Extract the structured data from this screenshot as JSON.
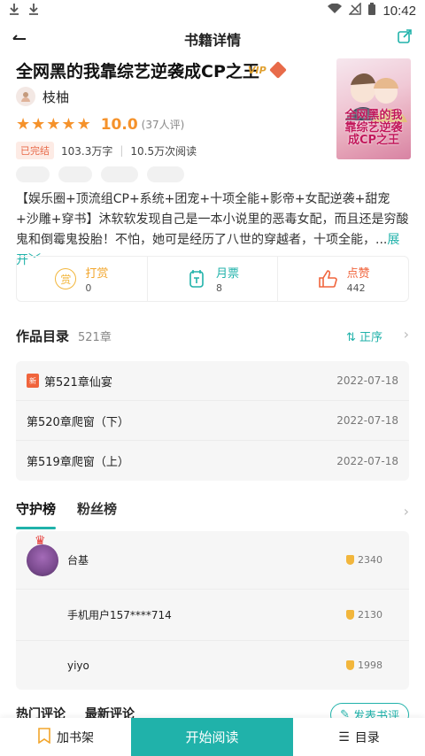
{
  "status_bar": {
    "time": "10:42",
    "left_icons": [
      "download-icon",
      "download-icon"
    ],
    "right_icons": [
      "wifi-icon",
      "signal-off-icon",
      "battery-icon"
    ]
  },
  "navbar": {
    "title": "书籍详情",
    "back_icon": "back-arrow-icon",
    "share_icon": "share-icon"
  },
  "book": {
    "title": "全网黑的我靠综艺逆袭成CP之王",
    "vip_label": "VIP",
    "author": "枝柚",
    "rating": 5,
    "score": "10.0",
    "reviews": "(37人评)",
    "status": "已完结",
    "word_count": "103.3万字",
    "separator": "|",
    "reads": "10.5万次阅读",
    "tags": [
      "",
      "",
      "",
      ""
    ],
    "cover_title": "全网黑的我靠综艺逆袭成CP之王",
    "description": "【娱乐圈+顶流组CP+系统+团宠+十项全能+影帝+女配逆袭+甜宠+沙雕+穿书】沐软软发现自己是一本小说里的恶毒女配，而且还是穷酸鬼和倒霉鬼投胎！不怕，她可是经历了八世的穿越者，十项全能，...",
    "more_label": "展开"
  },
  "actions": [
    {
      "icon": "reward-icon",
      "label": "打赏",
      "count": "0",
      "color": "#f2b63c"
    },
    {
      "icon": "monthly-ticket-icon",
      "label": "月票",
      "count": "8",
      "color": "#20b2aa"
    },
    {
      "icon": "thumbs-up-icon",
      "label": "点赞",
      "count": "442",
      "color": "#f0643c"
    }
  ],
  "toc": {
    "title": "作品目录",
    "count": "521章",
    "sort_label": "正序",
    "chapters": [
      {
        "new": true,
        "new_label": "新",
        "title": "第521章仙宴",
        "date": "2022-07-18"
      },
      {
        "new": false,
        "title": "第520章爬窗（下）",
        "date": "2022-07-18"
      },
      {
        "new": false,
        "title": "第519章爬窗（上）",
        "date": "2022-07-18"
      }
    ]
  },
  "ranks": {
    "tabs": [
      "守护榜",
      "粉丝榜"
    ],
    "items": [
      {
        "name": "台基",
        "value": "2340",
        "has_avatar": true
      },
      {
        "name": "手机用户157****714",
        "value": "2130",
        "has_avatar": false
      },
      {
        "name": "yiyo",
        "value": "1998",
        "has_avatar": false
      }
    ]
  },
  "comments": {
    "tabs": [
      "热门评论",
      "最新评论"
    ],
    "post_label": "发表书评"
  },
  "bottom_bar": {
    "shelf_label": "加书架",
    "read_label": "开始阅读",
    "catalog_label": "目录"
  },
  "colors": {
    "accent": "#20b2aa",
    "star": "#f5922b",
    "status_red": "#e86b4a"
  }
}
